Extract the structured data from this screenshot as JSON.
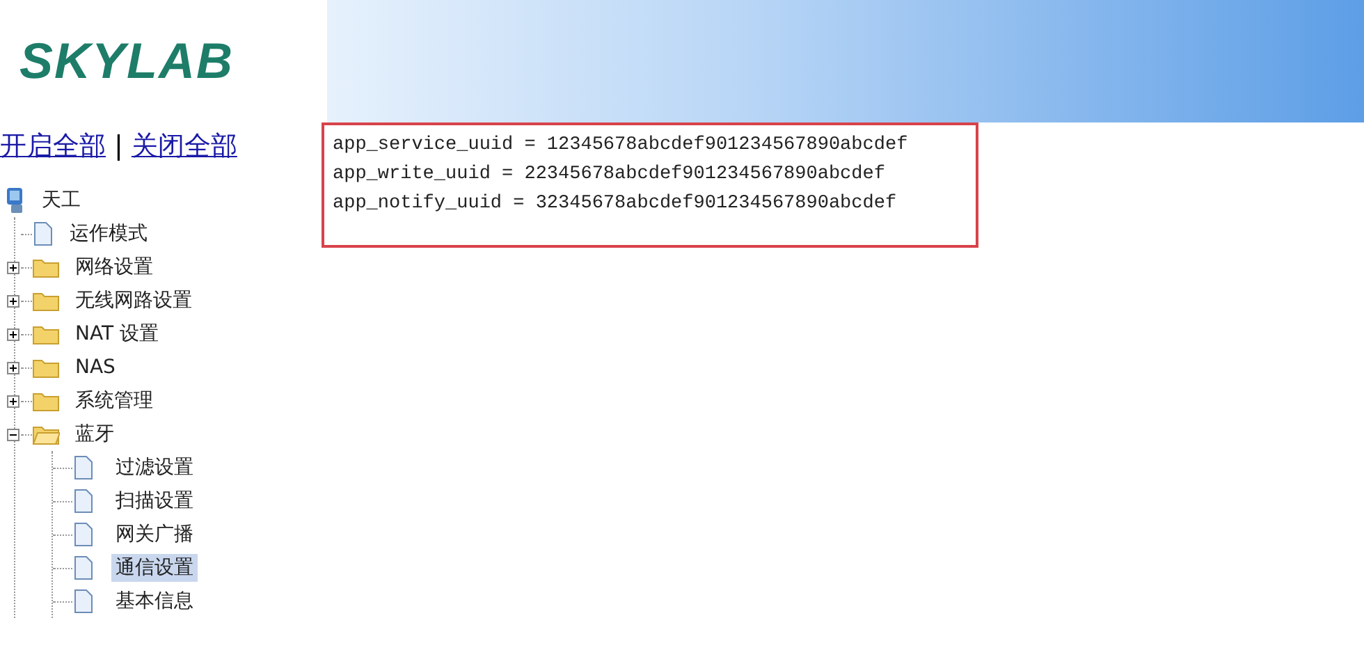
{
  "logo": {
    "text": "SKYLAB"
  },
  "toggle_links": [
    {
      "label": "开启全部"
    },
    {
      "label": "关闭全部"
    }
  ],
  "separator": "|",
  "tree": {
    "label": "天工",
    "children": [
      {
        "label": "运作模式",
        "kind": "page",
        "selected": false
      },
      {
        "label": "网络设置",
        "kind": "folder",
        "expanded": false,
        "selected": false
      },
      {
        "label": "无线网路设置",
        "kind": "folder",
        "expanded": false,
        "selected": false
      },
      {
        "label": "NAT 设置",
        "kind": "folder",
        "expanded": false,
        "selected": false
      },
      {
        "label": "NAS",
        "kind": "folder",
        "expanded": false,
        "selected": false
      },
      {
        "label": "系统管理",
        "kind": "folder",
        "expanded": false,
        "selected": false
      },
      {
        "label": "蓝牙",
        "kind": "folder",
        "expanded": true,
        "selected": false,
        "children": [
          {
            "label": "过滤设置",
            "kind": "page",
            "selected": false
          },
          {
            "label": "扫描设置",
            "kind": "page",
            "selected": false
          },
          {
            "label": "网关广播",
            "kind": "page",
            "selected": false
          },
          {
            "label": "通信设置",
            "kind": "page",
            "selected": true
          },
          {
            "label": "基本信息",
            "kind": "page",
            "selected": false
          }
        ]
      }
    ]
  },
  "config_lines": [
    "app_service_uuid = 12345678abcdef901234567890abcdef",
    "app_write_uuid = 22345678abcdef901234567890abcdef",
    "app_notify_uuid = 32345678abcdef901234567890abcdef"
  ]
}
